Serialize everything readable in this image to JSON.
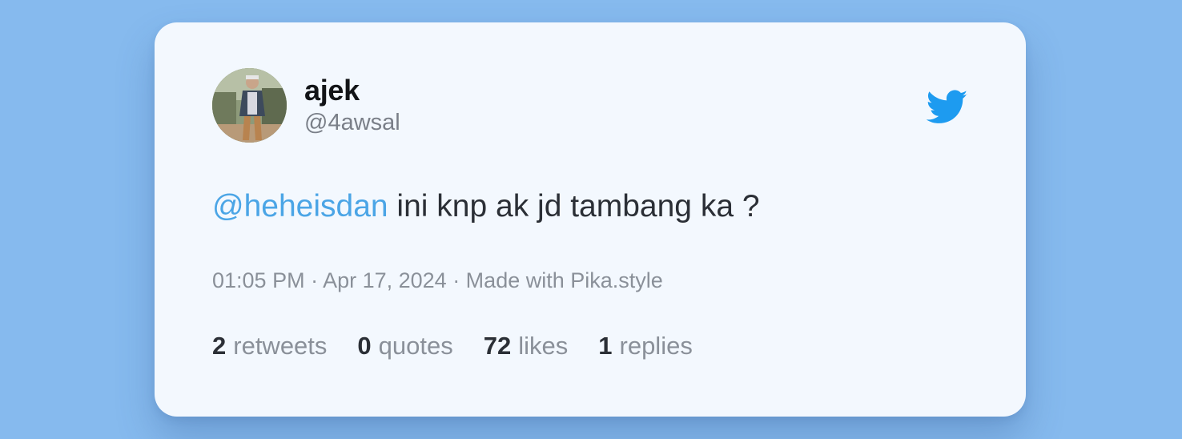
{
  "tweet": {
    "author": {
      "name": "ajek",
      "handle": "@4awsal",
      "avatar_icon": "avatar-photo"
    },
    "brand_icon": "twitter-bird-icon",
    "brand_color": "#1d9bf0",
    "body": {
      "mention": "@heheisdan",
      "text": " ini knp ak jd tambang ka ?"
    },
    "meta": "01:05 PM · Apr 17, 2024 · Made with Pika.style",
    "stats": [
      {
        "count": "2",
        "label": "retweets"
      },
      {
        "count": "0",
        "label": "quotes"
      },
      {
        "count": "72",
        "label": "likes"
      },
      {
        "count": "1",
        "label": "replies"
      }
    ]
  },
  "colors": {
    "background": "#86baee",
    "card": "#f3f8fe",
    "mention": "#4ba5e6"
  }
}
